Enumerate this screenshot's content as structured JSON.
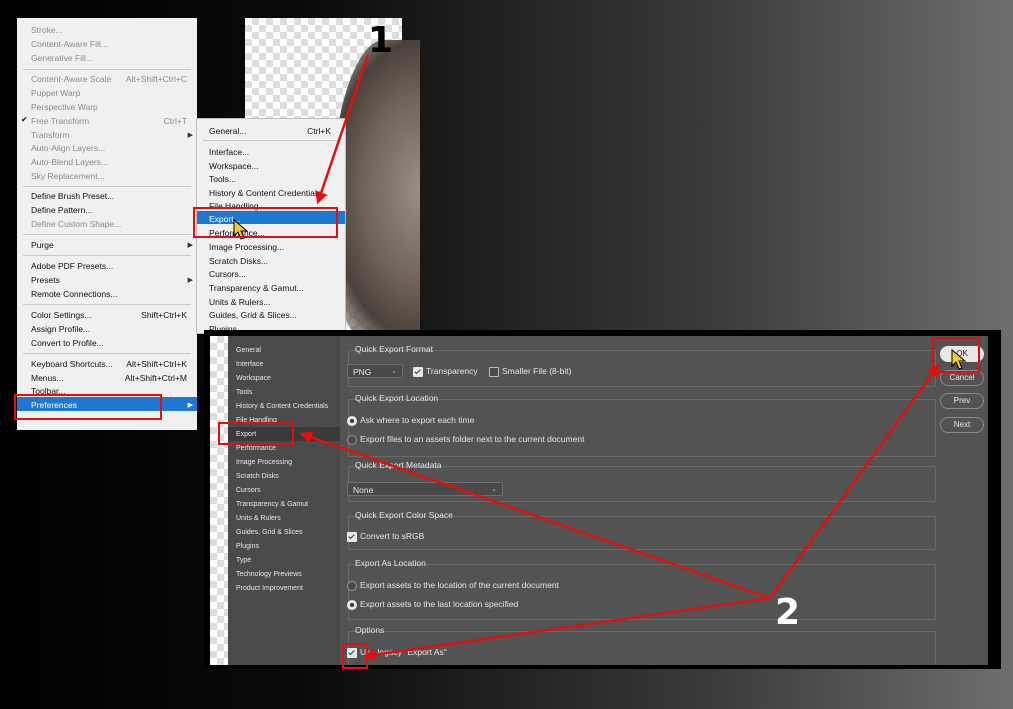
{
  "edit_menu": {
    "items": [
      {
        "label": "Stroke...",
        "shortcut": "",
        "disabled": true
      },
      {
        "label": "Content-Aware Fill...",
        "shortcut": "",
        "disabled": true
      },
      {
        "label": "Generative Fill...",
        "shortcut": "",
        "disabled": true
      },
      {
        "label": "Content-Aware Scale",
        "shortcut": "Alt+Shift+Ctrl+C",
        "disabled": true
      },
      {
        "label": "Puppet Warp",
        "shortcut": "",
        "disabled": true
      },
      {
        "label": "Perspective Warp",
        "shortcut": "",
        "disabled": true
      },
      {
        "label": "Free Transform",
        "shortcut": "Ctrl+T",
        "disabled": true
      },
      {
        "label": "Transform",
        "shortcut": "",
        "disabled": true
      },
      {
        "label": "Auto-Align Layers...",
        "shortcut": "",
        "disabled": true
      },
      {
        "label": "Auto-Blend Layers...",
        "shortcut": "",
        "disabled": true
      },
      {
        "label": "Sky Replacement...",
        "shortcut": "",
        "disabled": true
      },
      {
        "label": "Define Brush Preset...",
        "shortcut": "",
        "disabled": false
      },
      {
        "label": "Define Pattern...",
        "shortcut": "",
        "disabled": false
      },
      {
        "label": "Define Custom Shape...",
        "shortcut": "",
        "disabled": true
      },
      {
        "label": "Purge",
        "shortcut": "",
        "disabled": false
      },
      {
        "label": "Adobe PDF Presets...",
        "shortcut": "",
        "disabled": false
      },
      {
        "label": "Presets",
        "shortcut": "",
        "disabled": false
      },
      {
        "label": "Remote Connections...",
        "shortcut": "",
        "disabled": false
      },
      {
        "label": "Color Settings...",
        "shortcut": "Shift+Ctrl+K",
        "disabled": false
      },
      {
        "label": "Assign Profile...",
        "shortcut": "",
        "disabled": false
      },
      {
        "label": "Convert to Profile...",
        "shortcut": "",
        "disabled": false
      },
      {
        "label": "Keyboard Shortcuts...",
        "shortcut": "Alt+Shift+Ctrl+K",
        "disabled": false
      },
      {
        "label": "Menus...",
        "shortcut": "Alt+Shift+Ctrl+M",
        "disabled": false
      },
      {
        "label": "Toolbar...",
        "shortcut": "",
        "disabled": false
      },
      {
        "label": "Preferences",
        "shortcut": "",
        "disabled": false
      }
    ]
  },
  "prefs_menu": {
    "items": [
      {
        "label": "General...",
        "shortcut": "Ctrl+K"
      },
      {
        "label": "Interface..."
      },
      {
        "label": "Workspace..."
      },
      {
        "label": "Tools..."
      },
      {
        "label": "History & Content Credentials..."
      },
      {
        "label": "File Handling..."
      },
      {
        "label": "Export..."
      },
      {
        "label": "Performance..."
      },
      {
        "label": "Image Processing..."
      },
      {
        "label": "Scratch Disks..."
      },
      {
        "label": "Cursors..."
      },
      {
        "label": "Transparency & Gamut..."
      },
      {
        "label": "Units & Rulers..."
      },
      {
        "label": "Guides, Grid & Slices..."
      },
      {
        "label": "Plugins..."
      }
    ]
  },
  "dialog": {
    "sidebar": [
      "General",
      "Interface",
      "Workspace",
      "Tools",
      "History & Content Credentials",
      "File Handling",
      "Export",
      "Performance",
      "Image Processing",
      "Scratch Disks",
      "Cursors",
      "Transparency & Gamut",
      "Units & Rulers",
      "Guides, Grid & Slices",
      "Plugins",
      "Type",
      "Technology Previews",
      "Product Improvement"
    ],
    "quick_export_format": {
      "title": "Quick Export Format",
      "format": "PNG",
      "transparency_label": "Transparency",
      "smaller_file_label": "Smaller File (8-bit)"
    },
    "quick_export_location": {
      "title": "Quick Export Location",
      "opt1": "Ask where to export each time",
      "opt2": "Export files to an assets folder next to the current document"
    },
    "quick_export_metadata": {
      "title": "Quick Export Metadata",
      "value": "None"
    },
    "quick_export_color_space": {
      "title": "Quick Export Color Space",
      "convert_label": "Convert to sRGB"
    },
    "export_as_location": {
      "title": "Export As Location",
      "opt1": "Export assets to the location of the current document",
      "opt2": "Export assets to the last location specified"
    },
    "options": {
      "title": "Options",
      "legacy_label": "Use legacy \"Export As\""
    },
    "buttons": {
      "ok": "OK",
      "cancel": "Cancel",
      "prev": "Prev",
      "next": "Next"
    }
  },
  "annotations": {
    "step1": "1",
    "step2": "2",
    "color": "#e01010"
  }
}
